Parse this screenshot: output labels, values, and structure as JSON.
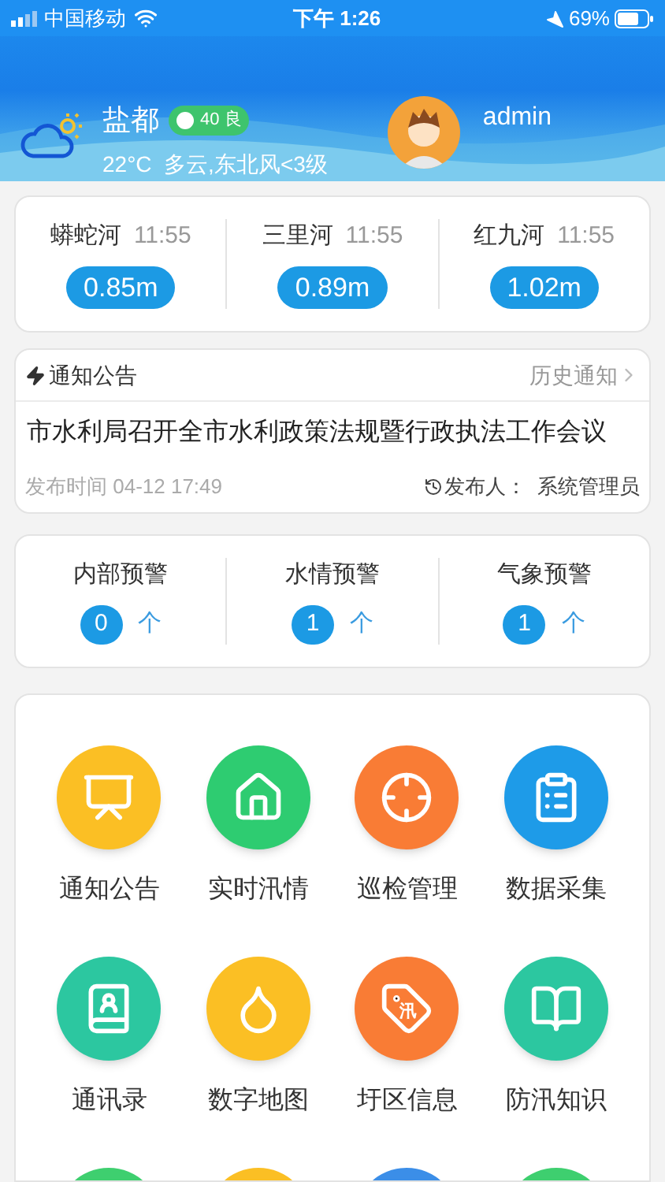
{
  "status_bar": {
    "carrier": "中国移动",
    "time": "下午 1:26",
    "battery": "69%"
  },
  "header": {
    "city": "盐都",
    "aqi": "40 良",
    "weather": "22°C  多云,东北风<3级",
    "user": "admin"
  },
  "rivers": [
    {
      "name": "蟒蛇河",
      "time": "11:55",
      "level_text": "0.85m"
    },
    {
      "name": "三里河",
      "time": "11:55",
      "level_text": "0.89m"
    },
    {
      "name": "红九河",
      "time": "11:55",
      "level_text": "1.02m"
    }
  ],
  "notice": {
    "title": "通知公告",
    "history": "历史通知",
    "headline": "市水利局召开全市水利政策法规暨行政执法工作会议",
    "published": "发布时间 04-12 17:49",
    "publisher": "发布人：  系统管理员"
  },
  "warnings": [
    {
      "label": "内部预警",
      "count": "0",
      "unit": "个"
    },
    {
      "label": "水情预警",
      "count": "1",
      "unit": "个"
    },
    {
      "label": "气象预警",
      "count": "1",
      "unit": "个"
    }
  ],
  "menu": [
    {
      "kind": "full",
      "label": "通知公告",
      "color": "#fbbf24"
    },
    {
      "kind": "full",
      "label": "实时汛情",
      "color": "#2ecc71"
    },
    {
      "kind": "full",
      "label": "巡检管理",
      "color": "#f97c35"
    },
    {
      "kind": "full",
      "label": "数据采集",
      "color": "#1e9be8"
    },
    {
      "kind": "full",
      "label": "通讯录",
      "color": "#2cc7a0"
    },
    {
      "kind": "full",
      "label": "数字地图",
      "color": "#fbbf24"
    },
    {
      "kind": "full",
      "label": "圩区信息",
      "color": "#f97c35",
      "badge": "汛"
    },
    {
      "kind": "full",
      "label": "防汛知识",
      "color": "#2cc7a0"
    },
    {
      "kind": "partial",
      "color": "#3ecf6f"
    },
    {
      "kind": "partial",
      "color": "#fbbf24"
    },
    {
      "kind": "partial",
      "color": "#3b8ee8"
    },
    {
      "kind": "partial",
      "color": "#3ecf6f"
    }
  ]
}
